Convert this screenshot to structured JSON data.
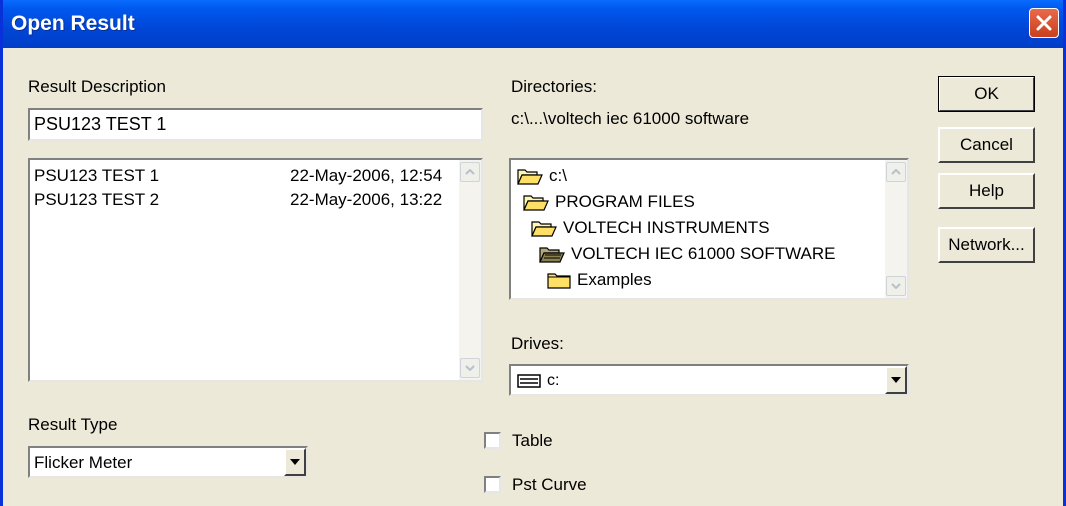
{
  "window": {
    "title": "Open Result",
    "close_icon": "close-icon"
  },
  "result_description": {
    "label": "Result Description",
    "value": "PSU123 TEST 1",
    "list": [
      {
        "name": "PSU123 TEST 1",
        "date": "22-May-2006, 12:54"
      },
      {
        "name": "PSU123 TEST 2",
        "date": "22-May-2006, 13:22"
      }
    ]
  },
  "directories": {
    "label": "Directories:",
    "current_path": "c:\\...\\voltech iec 61000 software",
    "tree": [
      {
        "name": "c:\\",
        "icon": "open-folder-icon"
      },
      {
        "name": "PROGRAM FILES",
        "icon": "open-folder-icon"
      },
      {
        "name": "VOLTECH INSTRUMENTS",
        "icon": "open-folder-icon"
      },
      {
        "name": "VOLTECH IEC 61000 SOFTWARE",
        "icon": "open-folder-selected-icon"
      },
      {
        "name": "Examples",
        "icon": "closed-folder-icon"
      }
    ]
  },
  "drives": {
    "label": "Drives:",
    "value": "c:",
    "icon": "drive-icon"
  },
  "result_type": {
    "label": "Result Type",
    "value": "Flicker Meter"
  },
  "options": {
    "table_label": "Table",
    "pst_curve_label": "Pst Curve",
    "table_checked": false,
    "pst_curve_checked": false
  },
  "buttons": {
    "ok": "OK",
    "cancel": "Cancel",
    "help": "Help",
    "network": "Network..."
  }
}
